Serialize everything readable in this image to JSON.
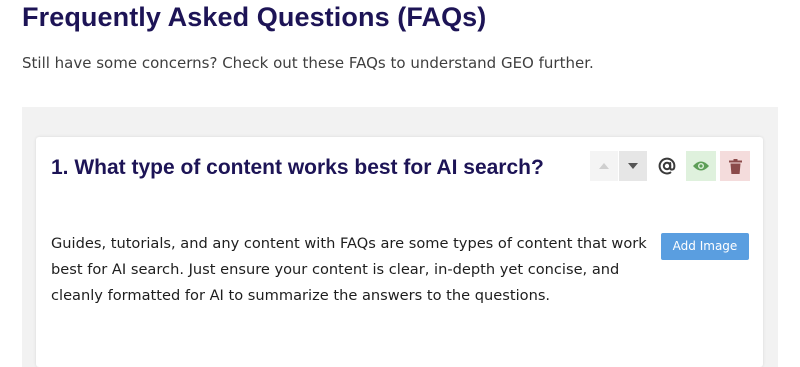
{
  "page": {
    "title": "Frequently Asked Questions (FAQs)",
    "intro": "Still have some concerns? Check out these FAQs to understand GEO further."
  },
  "faq_item": {
    "question": "1. What type of content works best for AI search?",
    "answer": "Guides, tutorials, and any content with FAQs are some types of content that work best for AI search. Just ensure your content is clear, in-depth yet concise, and cleanly formatted for AI to summarize the answers to the questions.",
    "add_image_label": "Add Image",
    "toolbar": {
      "icons": [
        "caret-up-icon",
        "caret-down-icon",
        "at-sign-icon",
        "eye-icon",
        "trash-icon"
      ]
    }
  },
  "colors": {
    "heading": "#1d1456",
    "panel_bg": "#f2f2f2",
    "button_blue": "#5a9ee0",
    "visible_green": "#dff1dd",
    "delete_red": "#f4dcdc"
  }
}
